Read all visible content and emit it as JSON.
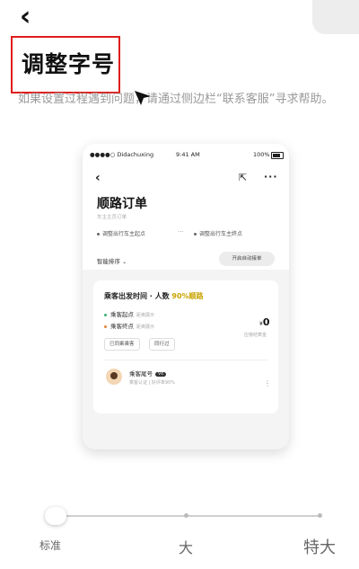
{
  "header": {
    "title": "调整字号",
    "help_text": "如果设置过程遇到问题，请通过侧边栏“联系客服”寻求帮助。"
  },
  "preview": {
    "status_bar": {
      "carrier": "Didachuxing",
      "time": "9:41 AM",
      "battery": "100%"
    },
    "page_title": "顺路订单",
    "subtitle": "车主主页订单",
    "route_start": "调整出行车主起点",
    "route_end": "调整出行车主终点",
    "route_dots": "···",
    "sort_label": "智能排序",
    "auto_accept_label": "开启自动接单",
    "order": {
      "title": "乘客出发时间 · 人数",
      "match": "90%顺路",
      "pickup_label": "乘客起点",
      "pickup_detail": "距离展示",
      "dropoff_label": "乘客终点",
      "dropoff_detail": "距离展示",
      "price_symbol": "¥",
      "price": "0",
      "price_note": "应缴结算金",
      "tag1": "已同乘乘客",
      "tag2": "同行过",
      "passenger_name": "乘客尾号",
      "passenger_badge": "V4",
      "passenger_sub": "乘客认证 | 好评率90%",
      "more": "⋮"
    }
  },
  "font_size_slider": {
    "labels": [
      "标准",
      "大",
      "特大"
    ],
    "selected": "标准"
  },
  "colors": {
    "title_box": "#e11d1d",
    "match_accent": "#c9a300"
  }
}
